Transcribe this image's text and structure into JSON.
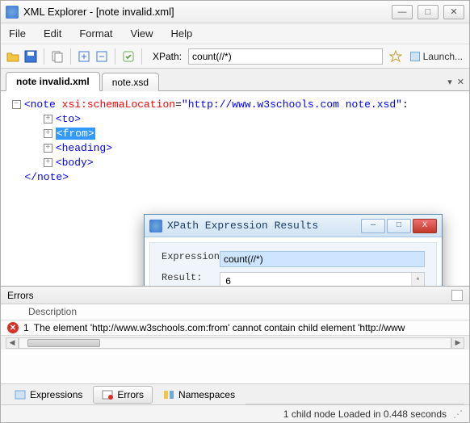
{
  "window": {
    "title": "XML Explorer - [note invalid.xml]"
  },
  "menu": {
    "file": "File",
    "edit": "Edit",
    "format": "Format",
    "view": "View",
    "help": "Help"
  },
  "toolbar": {
    "xpath_label": "XPath:",
    "xpath_value": "count(//*)",
    "launch": "Launch..."
  },
  "tabs": {
    "active": "note invalid.xml",
    "other": "note.xsd"
  },
  "xml": {
    "root_open": "<note",
    "root_attr_name": "xsi:schemaLocation",
    "root_attr_eq": "=",
    "root_attr_val": "\"http://www.w3schools.com note.xsd\"",
    "root_tail": ":",
    "to_open": "<to>",
    "from_open": "<from>",
    "heading_open": "<heading>",
    "body_open": "<body>",
    "root_close": "</note>"
  },
  "dialog": {
    "title": "XPath Expression Results",
    "expr_label": "Expression:",
    "expr_value": "count(//*)",
    "result_label": "Result:",
    "result_value": "6"
  },
  "errors": {
    "panel_title": "Errors",
    "col_desc": "Description",
    "row_num": "1",
    "row_text": "The element 'http://www.w3schools.com:from' cannot contain child element 'http://www"
  },
  "bottom_tabs": {
    "expressions": "Expressions",
    "errors": "Errors",
    "namespaces": "Namespaces"
  },
  "status": {
    "text": "1 child node  Loaded in 0.448 seconds"
  }
}
